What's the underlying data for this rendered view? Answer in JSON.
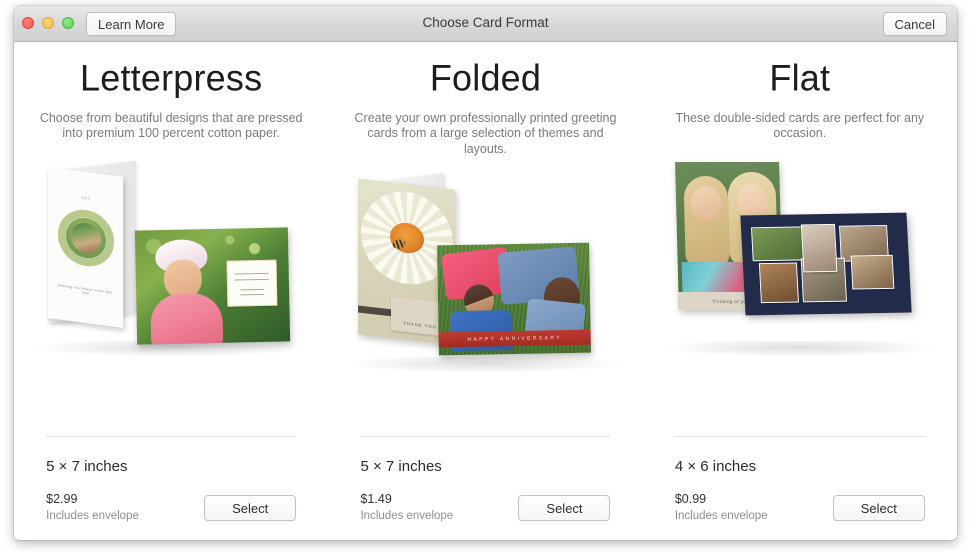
{
  "window": {
    "title": "Choose Card Format",
    "learn_more_label": "Learn More",
    "cancel_label": "Cancel",
    "traffic_lights": {
      "close": "close-button",
      "minimize": "minimize-button",
      "maximize": "maximize-button"
    }
  },
  "formats": [
    {
      "title": "Letterpress",
      "description": "Choose from beautiful designs that are pressed into premium 100 percent cotton paper.",
      "size": "5 × 7 inches",
      "price": "$2.99",
      "envelope_note": "Includes envelope",
      "select_label": "Select",
      "artwork": {
        "standing_card_header": "2013",
        "standing_card_footer": "Wishing You Peace in the New Year",
        "flat_card_note_lines": [
          "Olivia",
          "is turning",
          "one",
          "Please join",
          "us on July 21st"
        ]
      }
    },
    {
      "title": "Folded",
      "description": "Create your own professionally printed greeting cards from a large selection of themes and layouts.",
      "size": "5 × 7 inches",
      "price": "$1.49",
      "envelope_note": "Includes envelope",
      "select_label": "Select",
      "artwork": {
        "standing_card_label": "THANK YOU",
        "flat_card_banner": "HAPPY ANNIVERSARY"
      }
    },
    {
      "title": "Flat",
      "description": "These double-sided cards are perfect for any occasion.",
      "size": "4 × 6 inches",
      "price": "$0.99",
      "envelope_note": "Includes envelope",
      "select_label": "Select",
      "artwork": {
        "portrait_caption": "Thinking of you"
      }
    }
  ],
  "colors": {
    "titlebar_top": "#e9e9e9",
    "titlebar_bottom": "#d1d1d1",
    "titlebar_border": "#b4b4b4",
    "body_background": "#ffffff",
    "heading_text": "#1d1d1d",
    "description_text": "#7b7b7b",
    "divider": "#e2e2e2",
    "price_text": "#303030",
    "muted_text": "#8e8e8e",
    "close_light": "#f9564c",
    "minimize_light": "#f7bd47",
    "maximize_light": "#5ed24f"
  }
}
